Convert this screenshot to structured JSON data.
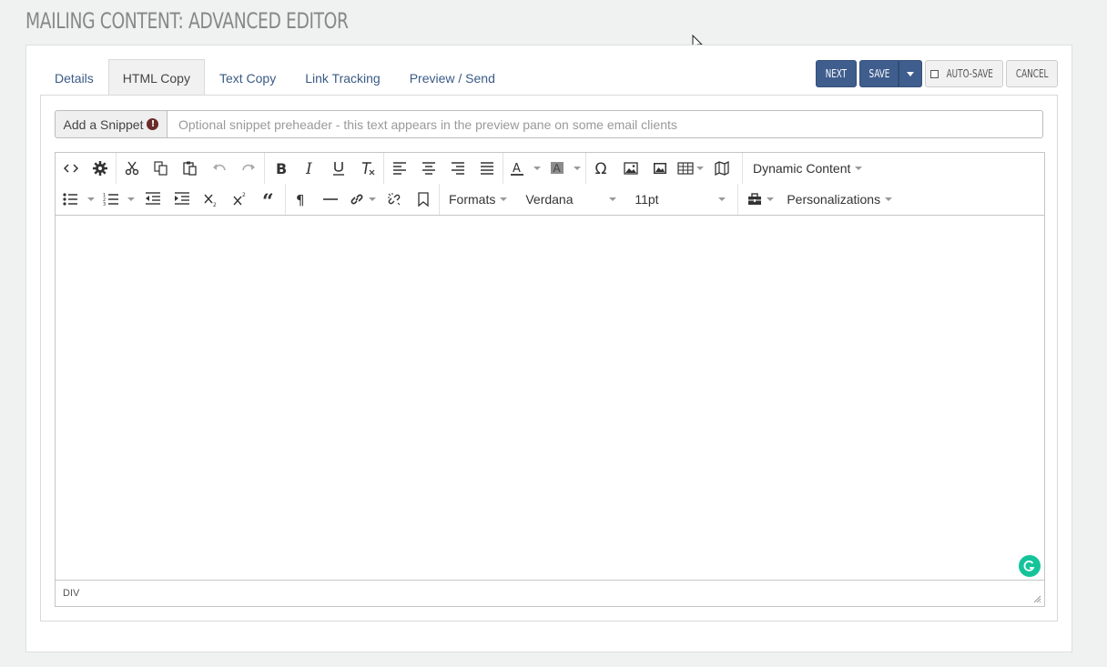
{
  "page": {
    "title": "MAILING CONTENT: ADVANCED EDITOR"
  },
  "tabs": [
    {
      "label": "Details",
      "active": false
    },
    {
      "label": "HTML Copy",
      "active": true
    },
    {
      "label": "Text Copy",
      "active": false
    },
    {
      "label": "Link Tracking",
      "active": false
    },
    {
      "label": "Preview / Send",
      "active": false
    }
  ],
  "actions": {
    "next_label": "NEXT",
    "save_label": "SAVE",
    "autosave_label": "AUTO-SAVE",
    "cancel_label": "CANCEL"
  },
  "snippet": {
    "button_label": "Add a Snippet",
    "alert_glyph": "!",
    "input_value": "",
    "input_placeholder": "Optional snippet preheader - this text appears in the preview pane on some email clients"
  },
  "toolbar": {
    "dynamic_content_label": "Dynamic Content",
    "formats_label": "Formats",
    "font_family_value": "Verdana",
    "font_size_value": "11pt",
    "personalizations_label": "Personalizations"
  },
  "statusbar": {
    "path": "DIV"
  },
  "colors": {
    "primary": "#3f5d8d",
    "tab_link": "#3a5a86",
    "grammarly": "#15c39a",
    "alert": "#6b2c2c"
  },
  "icons": {
    "toolbar_row1": [
      "source-code-icon",
      "settings-gear-icon",
      "cut-icon",
      "copy-icon",
      "paste-icon",
      "undo-icon",
      "redo-icon",
      "bold-icon",
      "italic-icon",
      "underline-icon",
      "clear-format-icon",
      "align-left-icon",
      "align-center-icon",
      "align-right-icon",
      "align-justify-icon",
      "text-color-icon",
      "background-color-icon",
      "special-char-omega-icon",
      "image-icon",
      "image-manager-icon",
      "table-icon",
      "map-icon"
    ],
    "toolbar_row2": [
      "bullet-list-icon",
      "numbered-list-icon",
      "outdent-icon",
      "indent-icon",
      "subscript-icon",
      "superscript-icon",
      "blockquote-icon",
      "paragraph-icon",
      "horizontal-rule-icon",
      "link-icon",
      "unlink-icon",
      "bookmark-icon",
      "toolbox-icon"
    ]
  }
}
